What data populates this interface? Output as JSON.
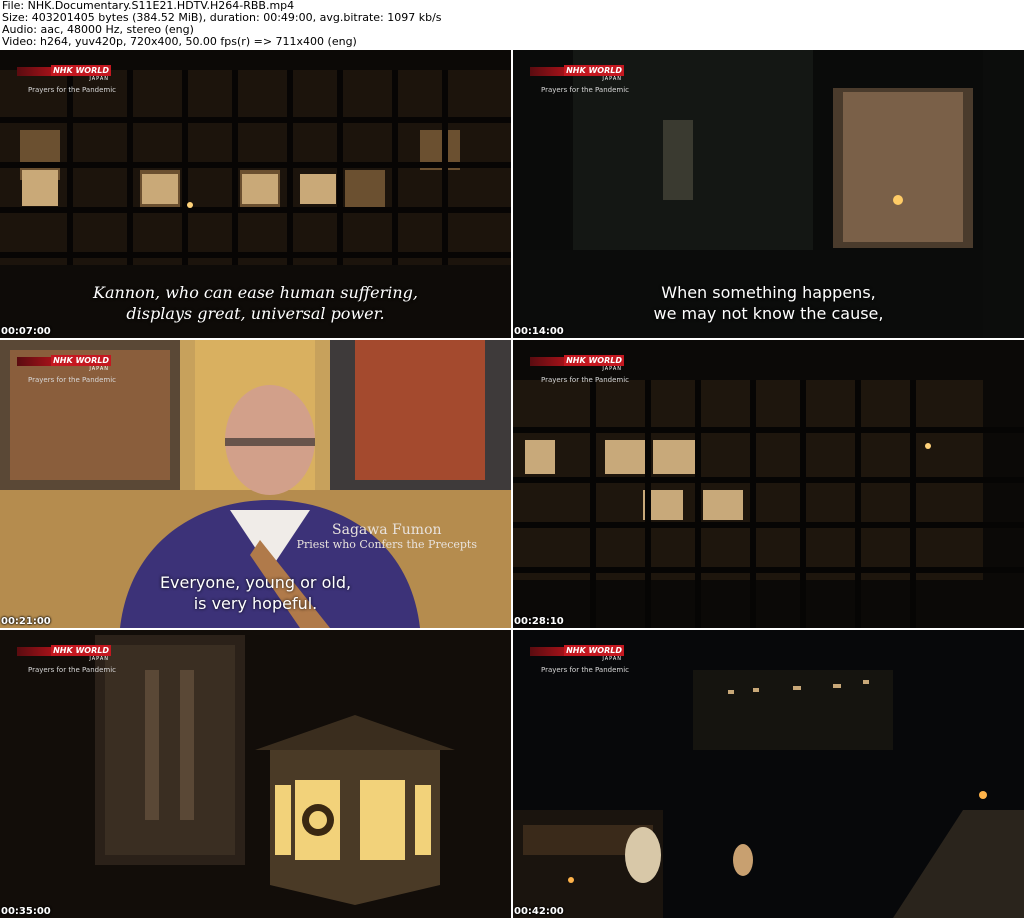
{
  "header": {
    "file": "File: NHK.Documentary.S11E21.HDTV.H264-RBB.mp4",
    "size": "Size: 403201405 bytes (384.52 MiB), duration: 00:49:00, avg.bitrate: 1097 kb/s",
    "audio": "Audio: aac, 48000 Hz, stereo (eng)",
    "video": "Video: h264, yuv420p, 720x400, 50.00 fps(r) => 711x400 (eng)"
  },
  "overlay": {
    "logo_text": "NHK WORLD",
    "logo_sub": "JAPAN",
    "program": "Prayers for the Pandemic"
  },
  "frames": [
    {
      "timestamp": "00:07:00",
      "line1": "Kannon, who can ease human suffering,",
      "line2": "displays great, universal power.",
      "style": "serif"
    },
    {
      "timestamp": "00:14:00",
      "line1": "When something happens,",
      "line2": "we may not know the cause,",
      "style": "sans"
    },
    {
      "timestamp": "00:21:00",
      "line1": "Everyone, young or old,",
      "line2": "is very hopeful.",
      "style": "sans",
      "speaker_name": "Sagawa Fumon",
      "speaker_role": "Priest who Confers the Precepts"
    },
    {
      "timestamp": "00:28:10"
    },
    {
      "timestamp": "00:35:00"
    },
    {
      "timestamp": "00:42:00"
    }
  ],
  "colors": {
    "logo_red": "#e21c24",
    "background": "#0b0a08"
  }
}
